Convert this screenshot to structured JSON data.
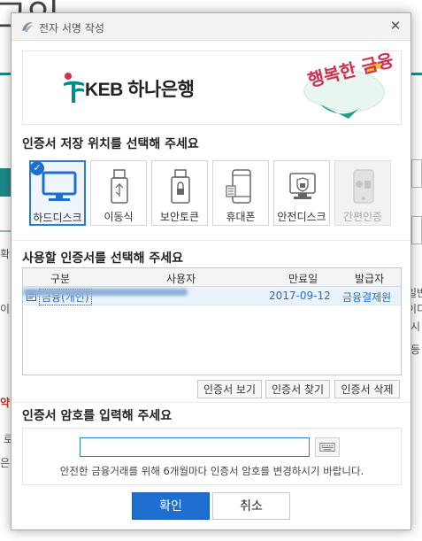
{
  "background_page": {
    "title_fragment": "그인",
    "left_fragments": [
      "은",
      "이",
      "약",
      "로",
      "은",
      "확"
    ],
    "right_fragments": [
      "일반",
      "이디",
      "시",
      "등"
    ]
  },
  "dialog": {
    "title": "전자 서명 작성",
    "close_glyph": "✕",
    "banner": {
      "bank_name": "KEB 하나은행",
      "slogan": "행복한 금융"
    },
    "storage_section_title": "인증서 저장 위치를 선택해 주세요",
    "storage_options": [
      {
        "label": "하드디스크",
        "icon": "monitor-icon",
        "selected": true,
        "disabled": false
      },
      {
        "label": "이동식",
        "icon": "usb-icon",
        "selected": false,
        "disabled": false
      },
      {
        "label": "보안토큰",
        "icon": "security-token-icon",
        "selected": false,
        "disabled": false
      },
      {
        "label": "휴대폰",
        "icon": "phone-icon",
        "selected": false,
        "disabled": false
      },
      {
        "label": "안전디스크",
        "icon": "safe-disk-icon",
        "selected": false,
        "disabled": false
      },
      {
        "label": "간편인증",
        "icon": "simple-auth-icon",
        "selected": false,
        "disabled": true
      }
    ],
    "cert_section_title": "사용할 인증서를 선택해 주세요",
    "cert_table": {
      "headers": [
        "구분",
        "사용자",
        "만료일",
        "발급자"
      ],
      "rows": [
        {
          "type": "금융(개인)",
          "user": "",
          "expires": "2017-09-12",
          "issuer": "금융결제원",
          "selected": true
        }
      ]
    },
    "cert_buttons": [
      "인증서 보기",
      "인증서 찾기",
      "인증서 삭제"
    ],
    "password_section_title": "인증서 암호를 입력해 주세요",
    "password": {
      "value": "",
      "placeholder": "",
      "keyboard_icon": "keyboard-icon",
      "hint": "안전한 금융거래를 위해 6개월마다 인증서 암호를 변경하시기 바랍니다."
    },
    "ok_label": "확인",
    "cancel_label": "취소"
  },
  "colors": {
    "accent": "#1f6fd0",
    "bank_teal": "#008c8c",
    "slogan_red": "#d22f54",
    "background_lane": "#1f8a8a"
  }
}
